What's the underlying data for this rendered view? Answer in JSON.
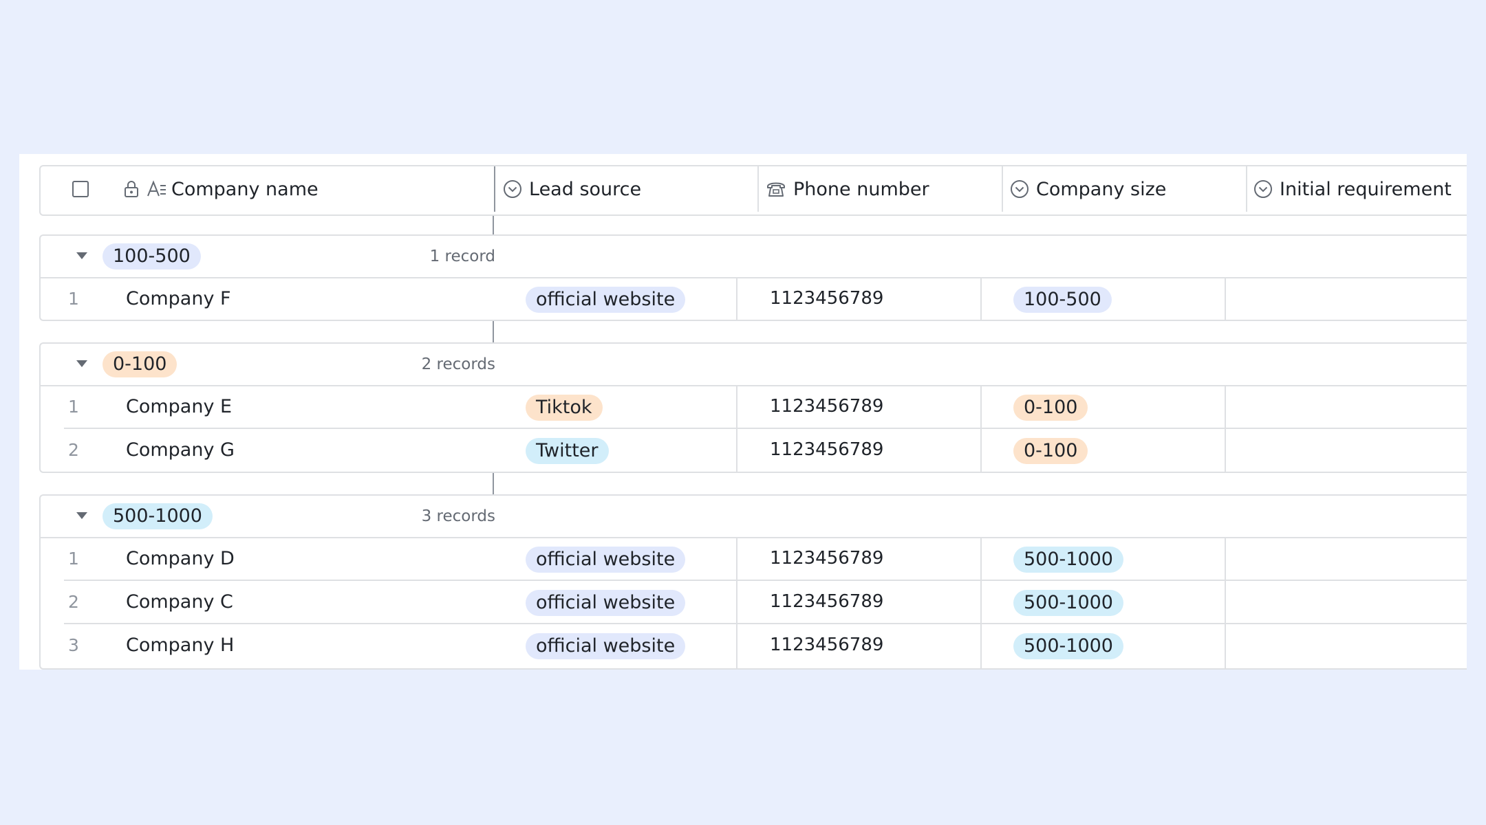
{
  "columns": {
    "company_name": "Company name",
    "lead_source": "Lead source",
    "phone_number": "Phone number",
    "company_size": "Company size",
    "initial_requirement": "Initial requirement"
  },
  "colors": {
    "tag_blue": "#e1e8fc",
    "tag_orange": "#fde3cb",
    "tag_cyan": "#d2eefa",
    "background": "#e9effd"
  },
  "groups": [
    {
      "label": "100-500",
      "count": "1 record",
      "rows": [
        {
          "index": "1",
          "company": "Company F",
          "lead_source": "official website",
          "phone": "1123456789",
          "size": "100-500"
        }
      ]
    },
    {
      "label": "0-100",
      "count": "2 records",
      "rows": [
        {
          "index": "1",
          "company": "Company E",
          "lead_source": "Tiktok",
          "phone": "1123456789",
          "size": "0-100"
        },
        {
          "index": "2",
          "company": "Company G",
          "lead_source": "Twitter",
          "phone": "1123456789",
          "size": "0-100"
        }
      ]
    },
    {
      "label": "500-1000",
      "count": "3 records",
      "rows": [
        {
          "index": "1",
          "company": "Company D",
          "lead_source": "official website",
          "phone": "1123456789",
          "size": "500-1000"
        },
        {
          "index": "2",
          "company": "Company C",
          "lead_source": "official website",
          "phone": "1123456789",
          "size": "500-1000"
        },
        {
          "index": "3",
          "company": "Company H",
          "lead_source": "official website",
          "phone": "1123456789",
          "size": "500-1000"
        }
      ]
    }
  ]
}
